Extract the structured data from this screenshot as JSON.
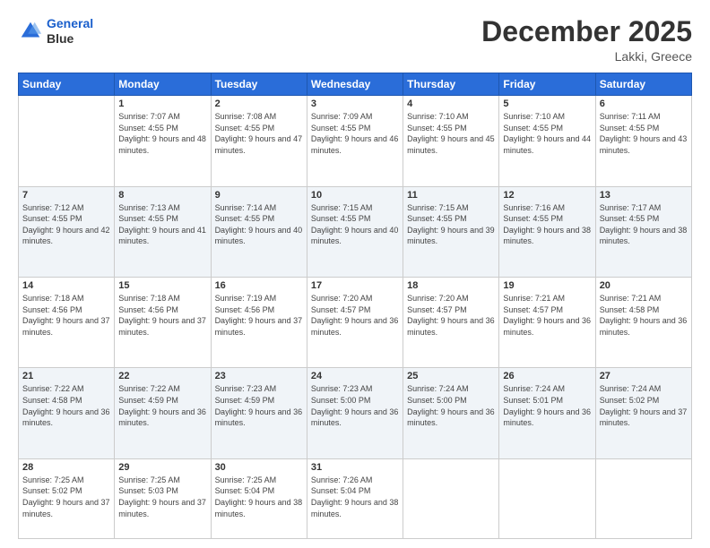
{
  "header": {
    "logo_line1": "General",
    "logo_line2": "Blue",
    "month": "December 2025",
    "location": "Lakki, Greece"
  },
  "weekdays": [
    "Sunday",
    "Monday",
    "Tuesday",
    "Wednesday",
    "Thursday",
    "Friday",
    "Saturday"
  ],
  "weeks": [
    [
      {
        "day": "",
        "sunrise": "",
        "sunset": "",
        "daylight": ""
      },
      {
        "day": "1",
        "sunrise": "Sunrise: 7:07 AM",
        "sunset": "Sunset: 4:55 PM",
        "daylight": "Daylight: 9 hours and 48 minutes."
      },
      {
        "day": "2",
        "sunrise": "Sunrise: 7:08 AM",
        "sunset": "Sunset: 4:55 PM",
        "daylight": "Daylight: 9 hours and 47 minutes."
      },
      {
        "day": "3",
        "sunrise": "Sunrise: 7:09 AM",
        "sunset": "Sunset: 4:55 PM",
        "daylight": "Daylight: 9 hours and 46 minutes."
      },
      {
        "day": "4",
        "sunrise": "Sunrise: 7:10 AM",
        "sunset": "Sunset: 4:55 PM",
        "daylight": "Daylight: 9 hours and 45 minutes."
      },
      {
        "day": "5",
        "sunrise": "Sunrise: 7:10 AM",
        "sunset": "Sunset: 4:55 PM",
        "daylight": "Daylight: 9 hours and 44 minutes."
      },
      {
        "day": "6",
        "sunrise": "Sunrise: 7:11 AM",
        "sunset": "Sunset: 4:55 PM",
        "daylight": "Daylight: 9 hours and 43 minutes."
      }
    ],
    [
      {
        "day": "7",
        "sunrise": "Sunrise: 7:12 AM",
        "sunset": "Sunset: 4:55 PM",
        "daylight": "Daylight: 9 hours and 42 minutes."
      },
      {
        "day": "8",
        "sunrise": "Sunrise: 7:13 AM",
        "sunset": "Sunset: 4:55 PM",
        "daylight": "Daylight: 9 hours and 41 minutes."
      },
      {
        "day": "9",
        "sunrise": "Sunrise: 7:14 AM",
        "sunset": "Sunset: 4:55 PM",
        "daylight": "Daylight: 9 hours and 40 minutes."
      },
      {
        "day": "10",
        "sunrise": "Sunrise: 7:15 AM",
        "sunset": "Sunset: 4:55 PM",
        "daylight": "Daylight: 9 hours and 40 minutes."
      },
      {
        "day": "11",
        "sunrise": "Sunrise: 7:15 AM",
        "sunset": "Sunset: 4:55 PM",
        "daylight": "Daylight: 9 hours and 39 minutes."
      },
      {
        "day": "12",
        "sunrise": "Sunrise: 7:16 AM",
        "sunset": "Sunset: 4:55 PM",
        "daylight": "Daylight: 9 hours and 38 minutes."
      },
      {
        "day": "13",
        "sunrise": "Sunrise: 7:17 AM",
        "sunset": "Sunset: 4:55 PM",
        "daylight": "Daylight: 9 hours and 38 minutes."
      }
    ],
    [
      {
        "day": "14",
        "sunrise": "Sunrise: 7:18 AM",
        "sunset": "Sunset: 4:56 PM",
        "daylight": "Daylight: 9 hours and 37 minutes."
      },
      {
        "day": "15",
        "sunrise": "Sunrise: 7:18 AM",
        "sunset": "Sunset: 4:56 PM",
        "daylight": "Daylight: 9 hours and 37 minutes."
      },
      {
        "day": "16",
        "sunrise": "Sunrise: 7:19 AM",
        "sunset": "Sunset: 4:56 PM",
        "daylight": "Daylight: 9 hours and 37 minutes."
      },
      {
        "day": "17",
        "sunrise": "Sunrise: 7:20 AM",
        "sunset": "Sunset: 4:57 PM",
        "daylight": "Daylight: 9 hours and 36 minutes."
      },
      {
        "day": "18",
        "sunrise": "Sunrise: 7:20 AM",
        "sunset": "Sunset: 4:57 PM",
        "daylight": "Daylight: 9 hours and 36 minutes."
      },
      {
        "day": "19",
        "sunrise": "Sunrise: 7:21 AM",
        "sunset": "Sunset: 4:57 PM",
        "daylight": "Daylight: 9 hours and 36 minutes."
      },
      {
        "day": "20",
        "sunrise": "Sunrise: 7:21 AM",
        "sunset": "Sunset: 4:58 PM",
        "daylight": "Daylight: 9 hours and 36 minutes."
      }
    ],
    [
      {
        "day": "21",
        "sunrise": "Sunrise: 7:22 AM",
        "sunset": "Sunset: 4:58 PM",
        "daylight": "Daylight: 9 hours and 36 minutes."
      },
      {
        "day": "22",
        "sunrise": "Sunrise: 7:22 AM",
        "sunset": "Sunset: 4:59 PM",
        "daylight": "Daylight: 9 hours and 36 minutes."
      },
      {
        "day": "23",
        "sunrise": "Sunrise: 7:23 AM",
        "sunset": "Sunset: 4:59 PM",
        "daylight": "Daylight: 9 hours and 36 minutes."
      },
      {
        "day": "24",
        "sunrise": "Sunrise: 7:23 AM",
        "sunset": "Sunset: 5:00 PM",
        "daylight": "Daylight: 9 hours and 36 minutes."
      },
      {
        "day": "25",
        "sunrise": "Sunrise: 7:24 AM",
        "sunset": "Sunset: 5:00 PM",
        "daylight": "Daylight: 9 hours and 36 minutes."
      },
      {
        "day": "26",
        "sunrise": "Sunrise: 7:24 AM",
        "sunset": "Sunset: 5:01 PM",
        "daylight": "Daylight: 9 hours and 36 minutes."
      },
      {
        "day": "27",
        "sunrise": "Sunrise: 7:24 AM",
        "sunset": "Sunset: 5:02 PM",
        "daylight": "Daylight: 9 hours and 37 minutes."
      }
    ],
    [
      {
        "day": "28",
        "sunrise": "Sunrise: 7:25 AM",
        "sunset": "Sunset: 5:02 PM",
        "daylight": "Daylight: 9 hours and 37 minutes."
      },
      {
        "day": "29",
        "sunrise": "Sunrise: 7:25 AM",
        "sunset": "Sunset: 5:03 PM",
        "daylight": "Daylight: 9 hours and 37 minutes."
      },
      {
        "day": "30",
        "sunrise": "Sunrise: 7:25 AM",
        "sunset": "Sunset: 5:04 PM",
        "daylight": "Daylight: 9 hours and 38 minutes."
      },
      {
        "day": "31",
        "sunrise": "Sunrise: 7:26 AM",
        "sunset": "Sunset: 5:04 PM",
        "daylight": "Daylight: 9 hours and 38 minutes."
      },
      {
        "day": "",
        "sunrise": "",
        "sunset": "",
        "daylight": ""
      },
      {
        "day": "",
        "sunrise": "",
        "sunset": "",
        "daylight": ""
      },
      {
        "day": "",
        "sunrise": "",
        "sunset": "",
        "daylight": ""
      }
    ]
  ]
}
